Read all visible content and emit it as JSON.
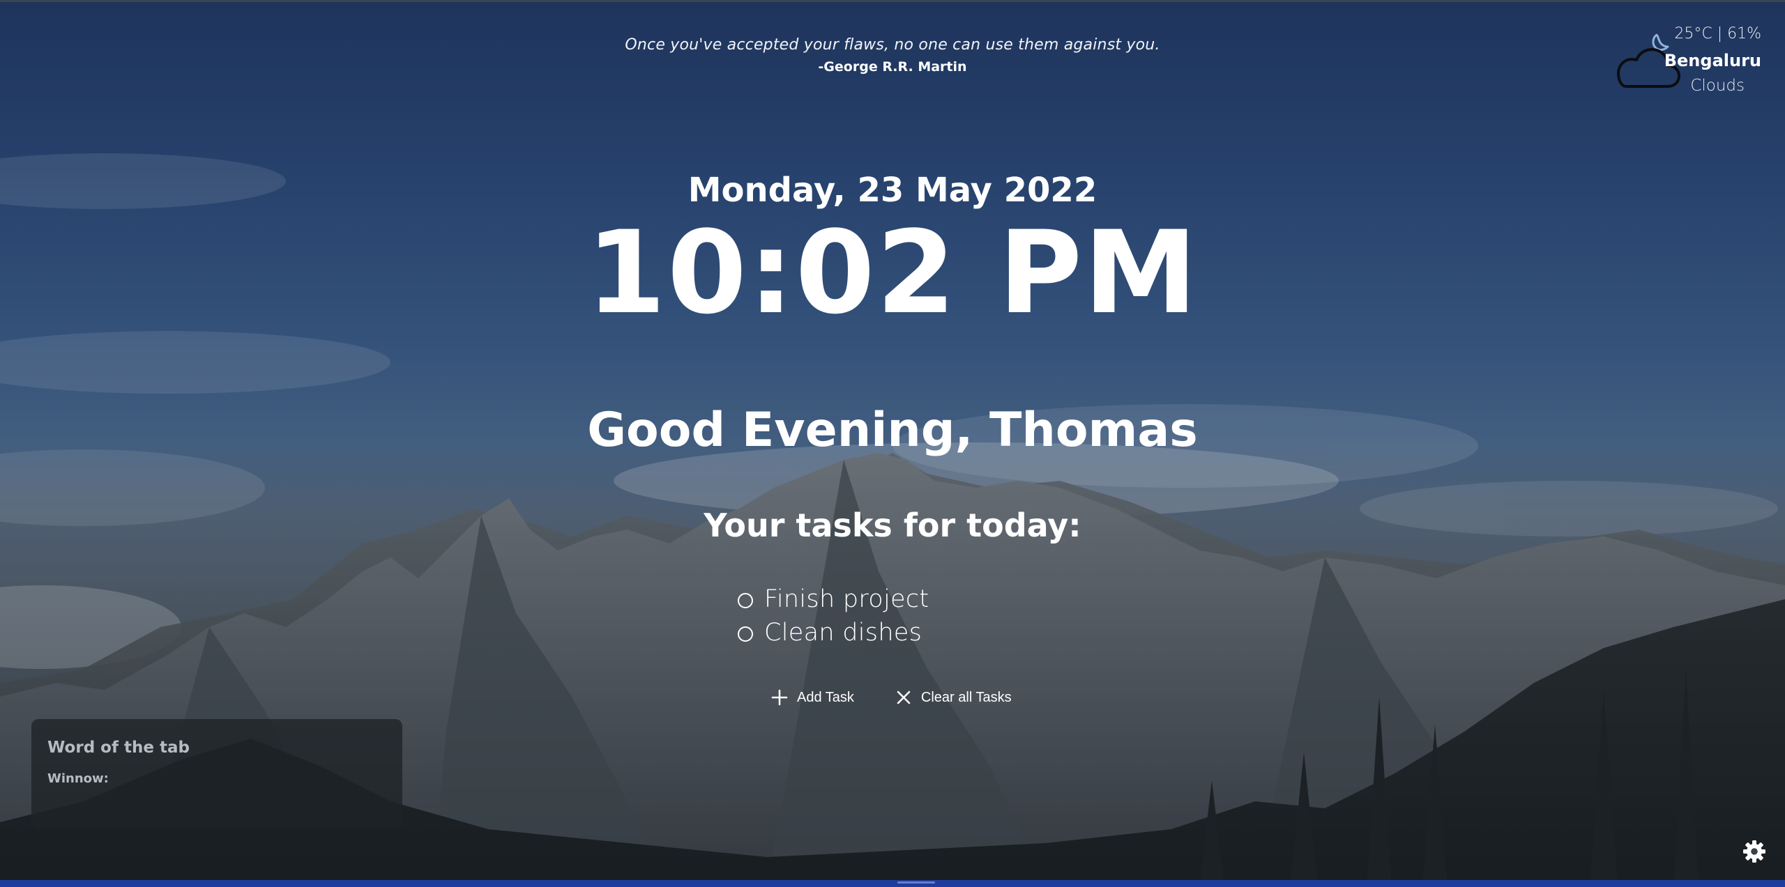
{
  "quote": {
    "text": "Once you've accepted your flaws, no one can use them against you.",
    "author": "-George R.R. Martin"
  },
  "weather": {
    "icon": "cloud-moon-icon",
    "temperature_humidity": "25°C | 61%",
    "city": "Bengaluru",
    "condition": "Clouds"
  },
  "clock": {
    "date": "Monday, 23 May 2022",
    "time": "10:02 PM"
  },
  "greeting": "Good Evening, Thomas",
  "tasks": {
    "heading": "Your tasks for today:",
    "items": [
      {
        "label": "Finish project",
        "done": false
      },
      {
        "label": "Clean dishes",
        "done": false
      }
    ],
    "add_label": "Add Task",
    "clear_label": "Clear all Tasks"
  },
  "word_of_tab": {
    "title": "Word of the tab",
    "term": "Winnow:"
  },
  "settings": {
    "icon": "gear-icon"
  },
  "colors": {
    "sky_top": "#233b69",
    "text": "#ffffff",
    "card_bg": "#1e2226",
    "card_text": "#b6bcc2",
    "bottom_bar": "#1f3da0"
  }
}
